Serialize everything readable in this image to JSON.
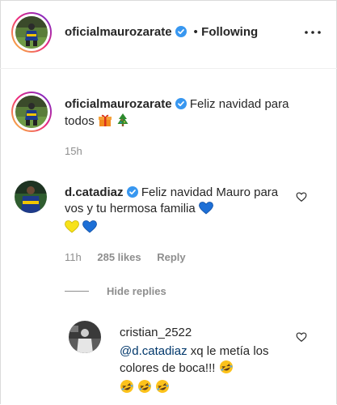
{
  "header": {
    "username": "oficialmaurozarate",
    "separator": "•",
    "follow_state": "Following"
  },
  "caption": {
    "username": "oficialmaurozarate",
    "text": "Feliz navidad para todos",
    "time": "15h"
  },
  "comment": {
    "username": "d.catadiaz",
    "text": "Feliz navidad Mauro para vos y tu hermosa familia",
    "time": "11h",
    "likes": "285 likes",
    "reply_label": "Reply",
    "hide_replies": "Hide replies"
  },
  "reply": {
    "username": "cristian_2522",
    "mention": "@d.catadiaz",
    "text": "xq le metía los colores de boca!!!"
  },
  "colors": {
    "verified": "#3897f0",
    "blue_heart": "#1d6fd6",
    "yellow_heart": "#f7e21a",
    "mention": "#00376b",
    "muted": "#8e8e8e"
  },
  "icons": [
    "verified-badge-icon",
    "more-options-icon",
    "gift-emoji-icon",
    "christmas-tree-emoji-icon",
    "blue-heart-emoji-icon",
    "yellow-heart-emoji-icon",
    "rolling-laughing-emoji-icon",
    "like-heart-icon"
  ]
}
